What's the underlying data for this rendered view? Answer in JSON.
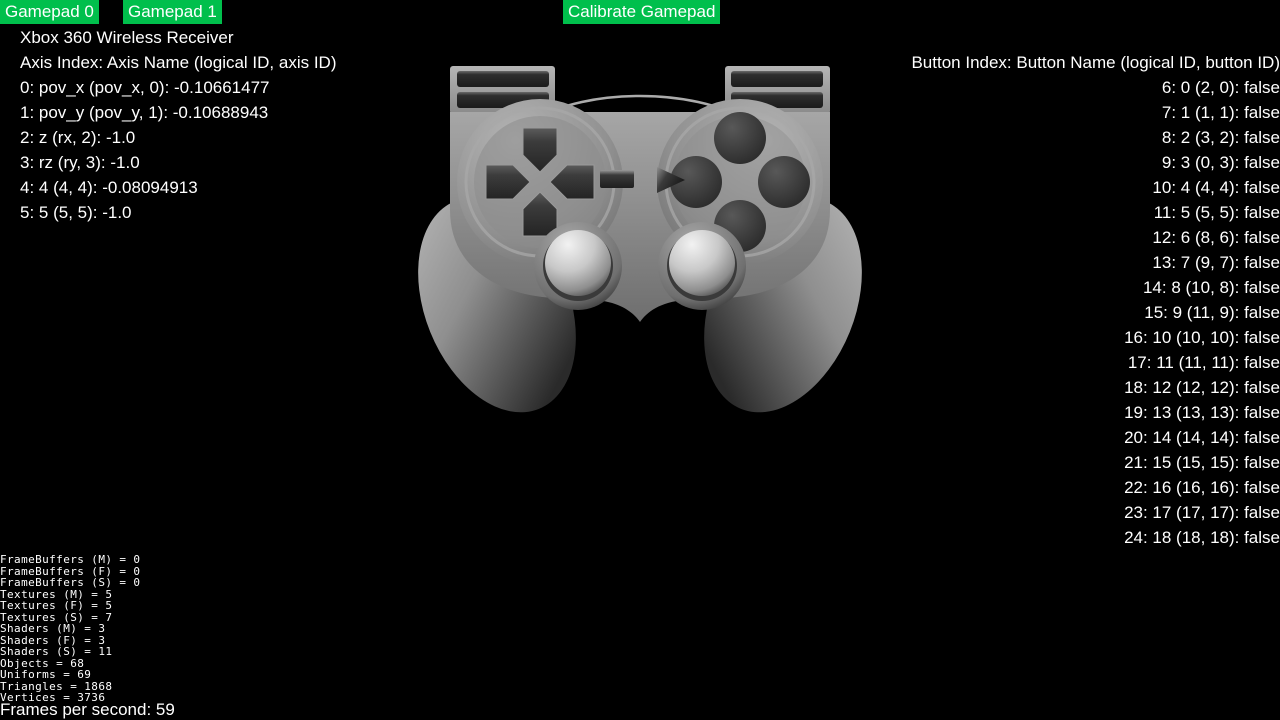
{
  "toolbar": {
    "tabs": [
      {
        "label": "Gamepad 0",
        "name": "tab-gamepad-0"
      },
      {
        "label": "Gamepad 1",
        "name": "tab-gamepad-1"
      }
    ],
    "calibrate_label": "Calibrate Gamepad",
    "accent_color": "#00bf4c"
  },
  "device": {
    "name": "Xbox 360 Wireless Receiver"
  },
  "axes": {
    "header": "Axis Index: Axis Name (logical ID, axis ID)",
    "rows": [
      "0: pov_x (pov_x, 0): -0.10661477",
      "1: pov_y (pov_y, 1): -0.10688943",
      "2: z (rx, 2): -1.0",
      "3: rz (ry, 3): -1.0",
      "4: 4 (4, 4): -0.08094913",
      "5: 5 (5, 5): -1.0"
    ]
  },
  "buttons": {
    "header": "Button Index: Button Name (logical ID, button ID)",
    "rows": [
      "6: 0 (2, 0): false",
      "7: 1 (1, 1): false",
      "8: 2 (3, 2): false",
      "9: 3 (0, 3): false",
      "10: 4 (4, 4): false",
      "11: 5 (5, 5): false",
      "12: 6 (8, 6): false",
      "13: 7 (9, 7): false",
      "14: 8 (10, 8): false",
      "15: 9 (11, 9): false",
      "16: 10 (10, 10): false",
      "17: 11 (11, 11): false",
      "18: 12 (12, 12): false",
      "19: 13 (13, 13): false",
      "20: 14 (14, 14): false",
      "21: 15 (15, 15): false",
      "22: 16 (16, 16): false",
      "23: 17 (17, 17): false",
      "24: 18 (18, 18): false"
    ]
  },
  "stats": {
    "lines": [
      "FrameBuffers (M) = 0",
      "FrameBuffers (F) = 0",
      "FrameBuffers (S) = 0",
      "Textures (M) = 5",
      "Textures (F) = 5",
      "Textures (S) = 7",
      "Shaders (M) = 3",
      "Shaders (F) = 3",
      "Shaders (S) = 11",
      "Objects = 68",
      "Uniforms = 69",
      "Triangles = 1868",
      "Vertices = 3736"
    ]
  },
  "fps": {
    "label": "Frames per second: 59"
  }
}
